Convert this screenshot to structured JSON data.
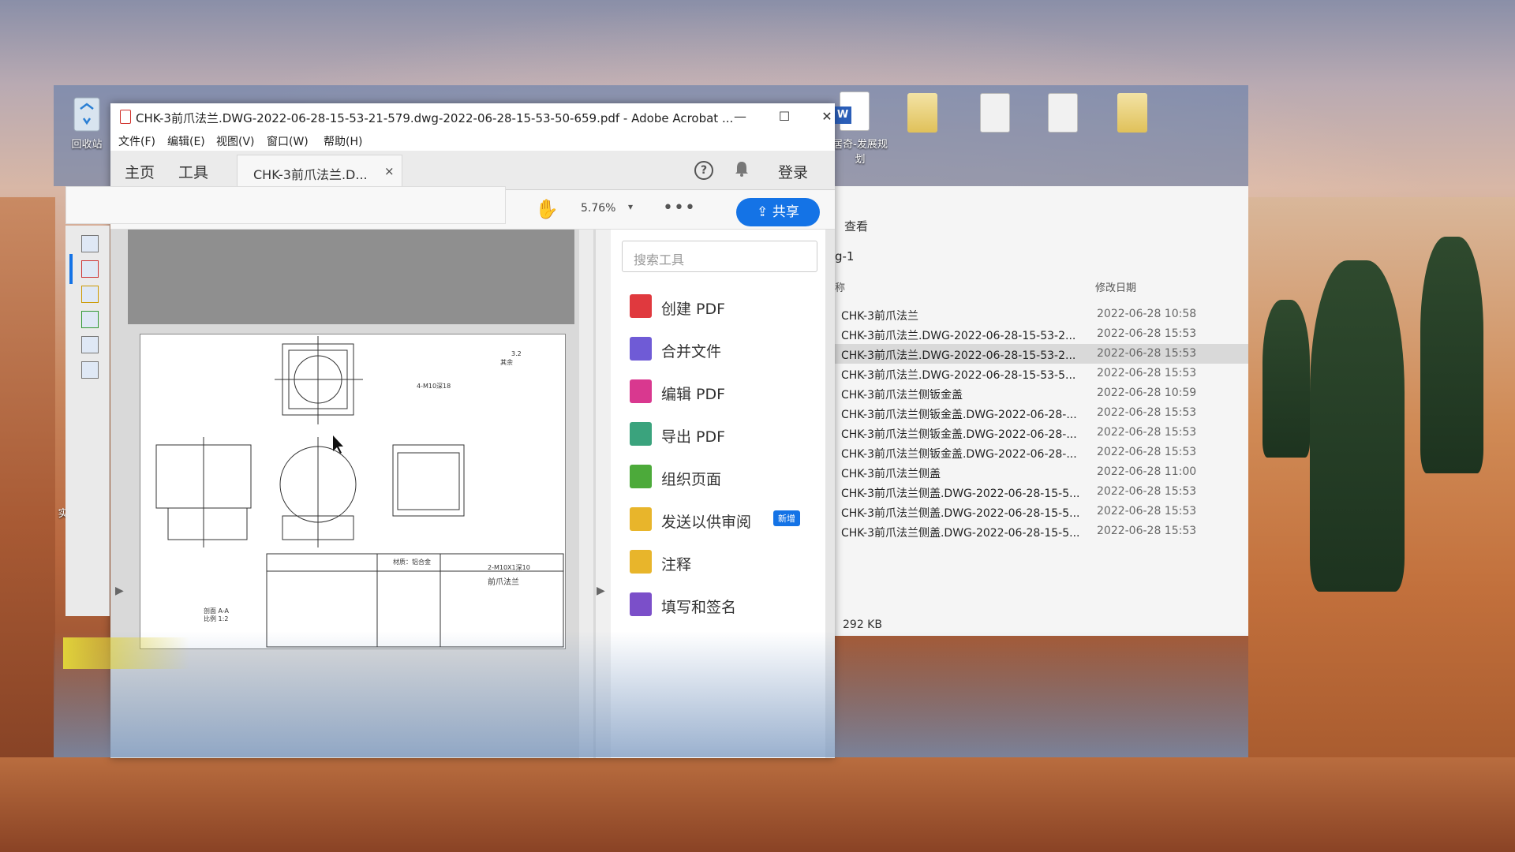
{
  "desktop": {
    "recycle_bin_label": "回收站",
    "word_doc_label": "居奇-发展规划",
    "left_edge_label": "实"
  },
  "explorer": {
    "view_label": "查看",
    "path_fragment": "g-1",
    "col_name": "称",
    "col_date": "修改日期",
    "rows": [
      {
        "name": "CHK-3前爪法兰",
        "date": "2022-06-28 10:58"
      },
      {
        "name": "CHK-3前爪法兰.DWG-2022-06-28-15-53-2...",
        "date": "2022-06-28 15:53"
      },
      {
        "name": "CHK-3前爪法兰.DWG-2022-06-28-15-53-2...",
        "date": "2022-06-28 15:53"
      },
      {
        "name": "CHK-3前爪法兰.DWG-2022-06-28-15-53-5...",
        "date": "2022-06-28 15:53"
      },
      {
        "name": "CHK-3前爪法兰侧钣金盖",
        "date": "2022-06-28 10:59"
      },
      {
        "name": "CHK-3前爪法兰侧钣金盖.DWG-2022-06-28-...",
        "date": "2022-06-28 15:53"
      },
      {
        "name": "CHK-3前爪法兰侧钣金盖.DWG-2022-06-28-...",
        "date": "2022-06-28 15:53"
      },
      {
        "name": "CHK-3前爪法兰侧钣金盖.DWG-2022-06-28-...",
        "date": "2022-06-28 15:53"
      },
      {
        "name": "CHK-3前爪法兰侧盖",
        "date": "2022-06-28 11:00"
      },
      {
        "name": "CHK-3前爪法兰侧盖.DWG-2022-06-28-15-5...",
        "date": "2022-06-28 15:53"
      },
      {
        "name": "CHK-3前爪法兰侧盖.DWG-2022-06-28-15-5...",
        "date": "2022-06-28 15:53"
      },
      {
        "name": "CHK-3前爪法兰侧盖.DWG-2022-06-28-15-5...",
        "date": "2022-06-28 15:53"
      }
    ],
    "selected_row": 2,
    "size_text": "292 KB"
  },
  "acrobat": {
    "title": "CHK-3前爪法兰.DWG-2022-06-28-15-53-21-579.dwg-2022-06-28-15-53-50-659.pdf - Adobe Acrobat ...",
    "window_buttons": {
      "minimize": "—",
      "maximize": "☐",
      "close": "✕"
    },
    "menu": [
      "文件(F)",
      "编辑(E)",
      "视图(V)",
      "窗口(W)",
      "帮助(H)"
    ],
    "tabs": {
      "home": "主页",
      "tools": "工具",
      "doc": "CHK-3前爪法兰.D...",
      "close": "×"
    },
    "help": "?",
    "bell": "🔔",
    "login": "登录",
    "toolbar": {
      "hand": "✋",
      "zoom": "5.76%",
      "zoom_caret": "▾",
      "more": "•••",
      "share": "共享",
      "share_icon": "⇪"
    },
    "tools_search_placeholder": "搜索工具",
    "tools": [
      {
        "label": "创建 PDF",
        "color": "#e0393e"
      },
      {
        "label": "合并文件",
        "color": "#6f5bd6"
      },
      {
        "label": "编辑 PDF",
        "color": "#d9388f"
      },
      {
        "label": "导出 PDF",
        "color": "#3aa37d"
      },
      {
        "label": "组织页面",
        "color": "#4caa3a"
      },
      {
        "label": "发送以供审阅",
        "color": "#e8b52b"
      },
      {
        "label": "注释",
        "color": "#e8b52b"
      },
      {
        "label": "填写和签名",
        "color": "#7b4fc9"
      }
    ],
    "new_badge": "新增",
    "drawing": {
      "title_block_name": "前爪法兰",
      "material": "材质：铝合金",
      "section_label": "剖面 A-A",
      "scale": "比例 1:2",
      "note_m10": "4-M10深18",
      "note_m10b": "2-M10X1深10",
      "roughness": "3.2",
      "rest": "其余"
    }
  },
  "colors": {
    "accent": "#1473e6",
    "selection": "#d9d9d9"
  }
}
